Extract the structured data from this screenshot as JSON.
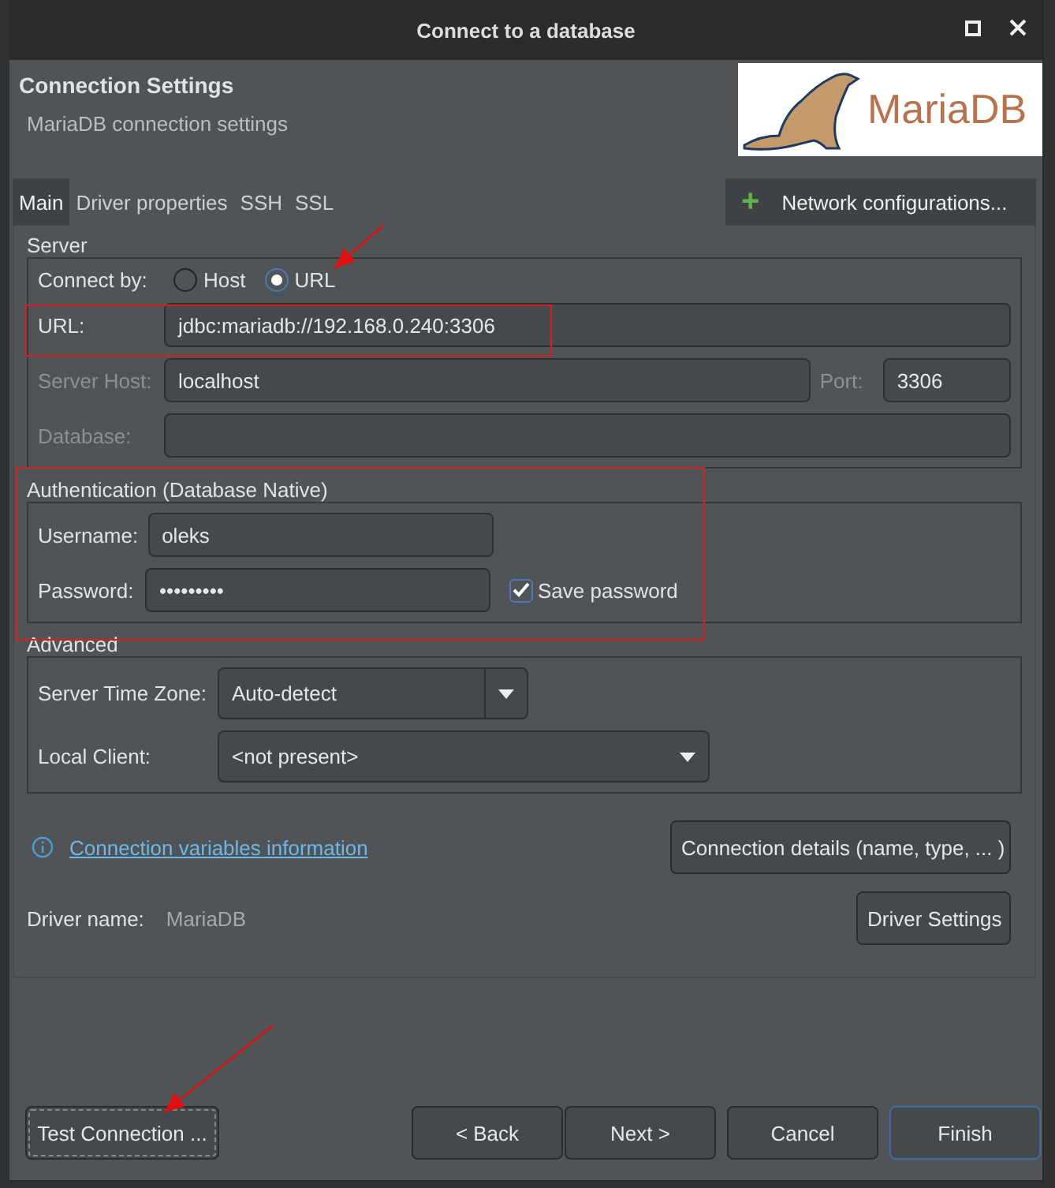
{
  "window": {
    "title": "Connect to a database"
  },
  "header": {
    "title": "Connection Settings",
    "subtitle": "MariaDB connection settings",
    "logo_text": "MariaDB"
  },
  "tabs": [
    {
      "label": "Main",
      "selected": true
    },
    {
      "label": "Driver properties",
      "selected": false
    },
    {
      "label": "SSH",
      "selected": false
    },
    {
      "label": "SSL",
      "selected": false
    }
  ],
  "network_button": {
    "icon": "+",
    "label": "Network configurations..."
  },
  "server": {
    "legend": "Server",
    "connect_by": {
      "label": "Connect by:",
      "options": [
        {
          "label": "Host",
          "selected": false
        },
        {
          "label": "URL",
          "selected": true
        }
      ]
    },
    "url": {
      "label": "URL:",
      "value": "jdbc:mariadb://192.168.0.240:3306",
      "disabled": false
    },
    "host": {
      "label": "Server Host:",
      "value": "localhost",
      "disabled": true
    },
    "port": {
      "label": "Port:",
      "value": "3306",
      "disabled": true
    },
    "database": {
      "label": "Database:",
      "disabled": true
    }
  },
  "auth": {
    "legend": "Authentication (Database Native)",
    "username": {
      "label": "Username:",
      "value": "oleks"
    },
    "password": {
      "label": "Password:",
      "value": "•••••••••"
    },
    "save_password": {
      "label": "Save password",
      "checked": true
    }
  },
  "advanced": {
    "legend": "Advanced",
    "time_zone": {
      "label": "Server Time Zone:",
      "value": "Auto-detect"
    },
    "local_client": {
      "label": "Local Client:",
      "value": "<not present>"
    }
  },
  "info_link": "Connection variables information",
  "details_button": "Connection details (name, type, ... )",
  "driver": {
    "label": "Driver name:",
    "value": "MariaDB"
  },
  "driver_settings_button": "Driver Settings",
  "test_button": "Test Connection ...",
  "buttons": [
    {
      "label": "< Back",
      "default": false
    },
    {
      "label": "Next >",
      "default": false
    },
    {
      "label": "Cancel",
      "default": false
    },
    {
      "label": "Finish",
      "default": true
    }
  ]
}
